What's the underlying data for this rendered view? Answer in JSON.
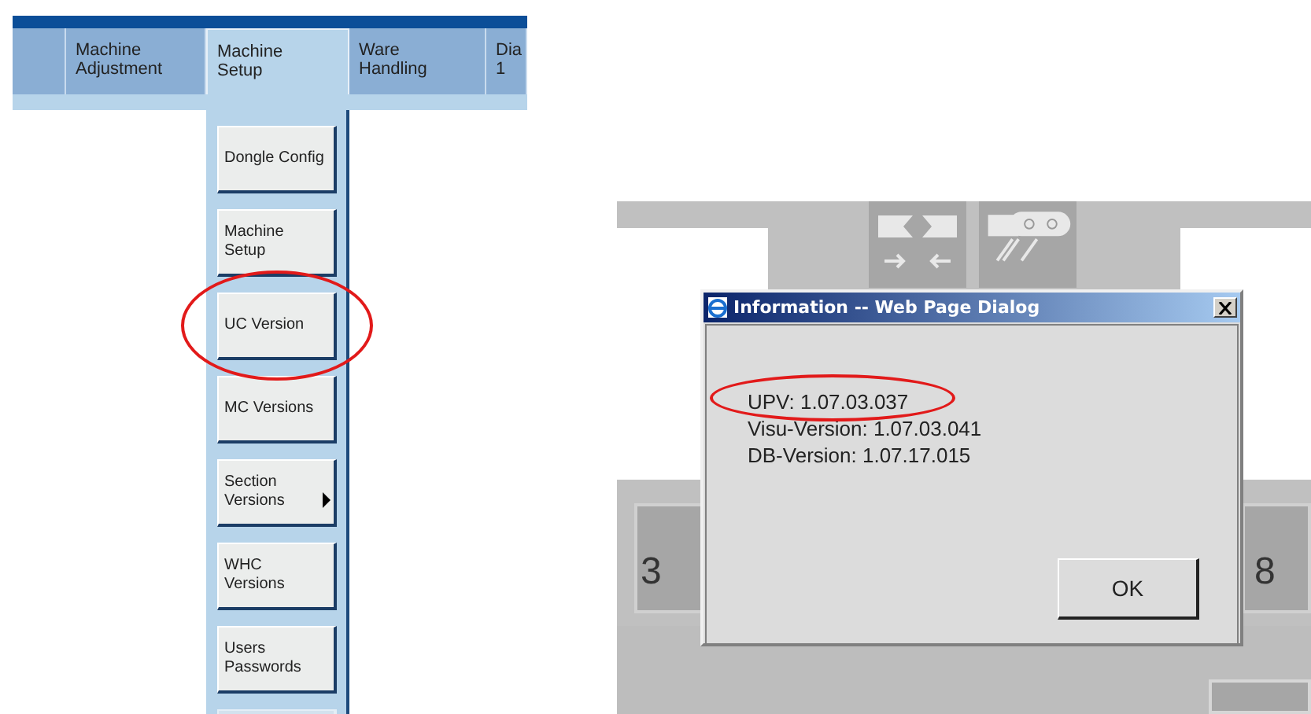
{
  "menu_screen": {
    "tabs": [
      {
        "label": "Machine\nAdjustment",
        "selected": false
      },
      {
        "label": "Machine\nSetup",
        "selected": true
      },
      {
        "label": "Ware\nHandling",
        "selected": false
      },
      {
        "label": "Dia\n1",
        "selected": false
      }
    ],
    "menu_items": [
      {
        "kind": "button",
        "label": "Dongle Config",
        "has_submenu": false,
        "circled": false
      },
      {
        "kind": "button",
        "label": "Machine\nSetup",
        "has_submenu": false,
        "circled": false
      },
      {
        "kind": "button",
        "label": "UC Version",
        "has_submenu": false,
        "circled": true
      },
      {
        "kind": "button",
        "label": "MC Versions",
        "has_submenu": false,
        "circled": false
      },
      {
        "kind": "button",
        "label": "Section\nVersions",
        "has_submenu": true,
        "circled": false
      },
      {
        "kind": "button",
        "label": "WHC\nVersions",
        "has_submenu": false,
        "circled": false
      },
      {
        "kind": "button",
        "label": "Users\nPasswords",
        "has_submenu": false,
        "circled": false
      },
      {
        "kind": "cut_off"
      }
    ]
  },
  "dialog_screen": {
    "tiles": [
      {
        "label": "3"
      },
      {
        "label": "8"
      }
    ],
    "dialog": {
      "title": "Information -- Web Page Dialog",
      "lines": [
        {
          "text": "UPV: 1.07.03.037",
          "circled": true
        },
        {
          "text": "Visu-Version: 1.07.03.041",
          "circled": false
        },
        {
          "text": "DB-Version: 1.07.17.015",
          "circled": false
        }
      ],
      "button": "OK"
    }
  }
}
